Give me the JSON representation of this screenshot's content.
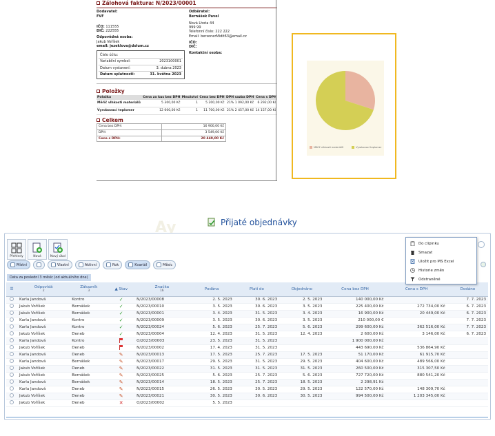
{
  "invoice": {
    "title": "Zálohová faktura: N/2023/00001",
    "supplier_label": "Dodavatel:",
    "supplier_name": "FVF",
    "ico_label": "IČO:",
    "ico_value": "111555",
    "dic_label": "DIČ:",
    "dic_value": "222555",
    "contact_label": "Odpovědná osoba:",
    "contact_name": "Jakub Voříšek",
    "contact_email": "email: jezeklova@dolum.cz",
    "customer_label": "Odběratel:",
    "customer_name": "Bernášek Pavel",
    "customer_lines": [
      "Nová Lhota 44",
      "999 99",
      "Telefonní číslo: 222 222",
      "Email: bersonerMidit63@email.cz"
    ],
    "customer_ico_label": "IČO:",
    "customer_dic_label": "DIČ:",
    "customer_contact_label": "Kontaktní osoba:",
    "box": {
      "account_label": "Číslo účtu:",
      "vs_label": "Variabilní symbol:",
      "vs_value": "2023100001",
      "issued_label": "Datum vystavení:",
      "issued_value": "3. dubna 2023",
      "due_label": "Datum splatnosti:",
      "due_value": "31. května 2023"
    },
    "items_title": "Položky",
    "items_headers": [
      "Položka",
      "Cena za kus bez DPH",
      "Množství",
      "Cena bez DPH",
      "DPH sazba DPH",
      "Cena s DPH"
    ],
    "items": [
      {
        "name": "Měřič vlhkosti materiálů",
        "unit": "5 300,00 Kč",
        "qty": "1",
        "net": "5 200,00 Kč",
        "vat": "21% 1 092,00 Kč",
        "gross": "6 292,00 Kč"
      },
      {
        "name": "Vyrobovací teplomer",
        "unit": "12 600,00 Kč",
        "qty": "1",
        "net": "11 700,00 Kč",
        "vat": "21% 2 457,00 Kč",
        "gross": "14 157,00 Kč"
      }
    ],
    "totals_title": "Celkem",
    "totals": [
      {
        "label": "Cena bez DPH:",
        "value": "16 900,00 Kč"
      },
      {
        "label": "DPH:",
        "value": "3 549,00 Kč"
      },
      {
        "label": "Cena s DPH:",
        "value": "20 449,00 Kč"
      }
    ]
  },
  "chart_data": {
    "type": "pie",
    "values": [
      0.3,
      0.7
    ],
    "colors": [
      "#e8b4a0",
      "#d4cf55"
    ],
    "legend": [
      "Měřič vlhkosti materiálů",
      "Vyrobovací teplomer"
    ]
  },
  "app": {
    "title": "Přijaté objednávky",
    "watermark": "Ay",
    "toolbar": [
      {
        "label": "Přehledy",
        "icon": "overview-grid-icon"
      },
      {
        "label": "Nová",
        "icon": "new-order-icon"
      },
      {
        "label": "Nový úkol",
        "icon": "new-task-icon"
      }
    ],
    "filters": [
      {
        "label": "Místní",
        "icon": "filter-icon"
      },
      {
        "label": "",
        "icon": "filter-mode-icon"
      },
      {
        "label": "Vlastní",
        "icon": "custom-filter-icon"
      },
      {
        "label": "Aktivní",
        "icon": "active-filter-icon"
      },
      {
        "label": "Rok",
        "icon": "calendar-year-icon"
      },
      {
        "label": "Kvartál",
        "icon": "calendar-quarter-icon"
      },
      {
        "label": "Měsíc",
        "icon": "calendar-month-icon"
      }
    ],
    "range_label": "Data za poslední 3 měsíc (od aktuálního dne)",
    "columns": {
      "menu": "☰",
      "owner": "Odpovídá",
      "owner_sub": "2",
      "customer": "Zákazník",
      "customer_sub": "3",
      "status": "Stav",
      "code": "Značka",
      "code_sub": "16",
      "filed": "Podána",
      "valid": "Platí do",
      "ordered": "Objednáno",
      "net": "Cena bez DPH",
      "gross": "Cena s DPH",
      "delivered": "Dodáno"
    },
    "rows": [
      {
        "owner": "Karla Jandová",
        "customer": "Kontro",
        "status": "ok",
        "code": "N/2023/00008",
        "filed": "2. 5. 2023",
        "valid": "30. 6. 2023",
        "ordered": "2. 5. 2023",
        "net": "140 000,00 Kč",
        "gross": "",
        "delivered": "7. 7. 2023"
      },
      {
        "owner": "Jakub Voříšek",
        "customer": "Bernášek",
        "status": "ok",
        "code": "N/2023/00010",
        "filed": "3. 5. 2023",
        "valid": "30. 6. 2023",
        "ordered": "3. 5. 2023",
        "net": "225 400,00 Kč",
        "gross": "272 734,00 Kč",
        "delivered": "6. 7. 2023"
      },
      {
        "owner": "Jakub Voříšek",
        "customer": "Bernášek",
        "status": "ok",
        "code": "N/2023/00001",
        "filed": "3. 4. 2023",
        "valid": "31. 5. 2023",
        "ordered": "3. 4. 2023",
        "net": "16 900,00 Kč",
        "gross": "20 449,00 Kč",
        "delivered": "6. 7. 2023"
      },
      {
        "owner": "Karla Jandová",
        "customer": "Kontro",
        "status": "ok",
        "code": "N/2023/00009",
        "filed": "3. 5. 2023",
        "valid": "30. 6. 2023",
        "ordered": "3. 5. 2023",
        "net": "210 000,00 €",
        "gross": "",
        "delivered": "7. 7. 2023"
      },
      {
        "owner": "Karla Jandová",
        "customer": "Kontro",
        "status": "ok",
        "code": "N/2023/00024",
        "filed": "5. 6. 2023",
        "valid": "25. 7. 2023",
        "ordered": "5. 6. 2023",
        "net": "299 600,00 Kč",
        "gross": "362 516,00 Kč",
        "delivered": "7. 7. 2023"
      },
      {
        "owner": "Jakub Voříšek",
        "customer": "Deneb",
        "status": "ok",
        "code": "N/2023/00004",
        "filed": "12. 4. 2023",
        "valid": "31. 5. 2023",
        "ordered": "12. 4. 2023",
        "net": "2 600,00 Kč",
        "gross": "3 146,00 Kč",
        "delivered": "6. 7. 2023"
      },
      {
        "owner": "Karla Jandová",
        "customer": "Kontro",
        "status": "flag",
        "code": "O/2023/00003",
        "filed": "23. 5. 2023",
        "valid": "31. 5. 2023",
        "ordered": "",
        "net": "1 900 000,00 Kč",
        "gross": "",
        "delivered": ""
      },
      {
        "owner": "Jakub Voříšek",
        "customer": "Deneb",
        "status": "flag",
        "code": "N/2023/00002",
        "filed": "17. 4. 2023",
        "valid": "31. 5. 2023",
        "ordered": "",
        "net": "443 690,00 Kč",
        "gross": "536 864,90 Kč",
        "delivered": ""
      },
      {
        "owner": "Karla Jandová",
        "customer": "Deneb",
        "status": "pen",
        "code": "N/2023/00013",
        "filed": "17. 5. 2023",
        "valid": "25. 7. 2023",
        "ordered": "17. 5. 2023",
        "net": "51 170,00 Kč",
        "gross": "61 915,70 Kč",
        "delivered": ""
      },
      {
        "owner": "Karla Jandová",
        "customer": "Bernášek",
        "status": "pen",
        "code": "N/2023/00017",
        "filed": "29. 5. 2023",
        "valid": "31. 5. 2023",
        "ordered": "29. 5. 2023",
        "net": "404 600,00 Kč",
        "gross": "489 566,00 Kč",
        "delivered": ""
      },
      {
        "owner": "Jakub Voříšek",
        "customer": "Deneb",
        "status": "pen",
        "code": "N/2023/00022",
        "filed": "31. 5. 2023",
        "valid": "31. 5. 2023",
        "ordered": "31. 5. 2023",
        "net": "260 500,00 Kč",
        "gross": "315 307,50 Kč",
        "delivered": ""
      },
      {
        "owner": "Jakub Voříšek",
        "customer": "Bernášek",
        "status": "pen",
        "code": "N/2023/00025",
        "filed": "5. 6. 2023",
        "valid": "25. 7. 2023",
        "ordered": "5. 6. 2023",
        "net": "727 720,00 Kč",
        "gross": "880 541,20 Kč",
        "delivered": ""
      },
      {
        "owner": "Karla Jandová",
        "customer": "Bernášek",
        "status": "pen",
        "code": "N/2023/00014",
        "filed": "18. 5. 2023",
        "valid": "25. 7. 2023",
        "ordered": "18. 5. 2023",
        "net": "2 298,91 Kč",
        "gross": "",
        "delivered": ""
      },
      {
        "owner": "Karla Jandová",
        "customer": "Deneb",
        "status": "pen",
        "code": "N/2023/00015",
        "filed": "26. 5. 2023",
        "valid": "30. 5. 2023",
        "ordered": "29. 5. 2023",
        "net": "122 570,00 Kč",
        "gross": "148 309,70 Kč",
        "delivered": ""
      },
      {
        "owner": "Jakub Voříšek",
        "customer": "Deneb",
        "status": "pen",
        "code": "N/2023/00021",
        "filed": "30. 5. 2023",
        "valid": "30. 6. 2023",
        "ordered": "30. 5. 2023",
        "net": "994 500,00 Kč",
        "gross": "1 203 345,00 Kč",
        "delivered": ""
      },
      {
        "owner": "Jakub Voříšek",
        "customer": "Deneb",
        "status": "x",
        "code": "O/2023/00002",
        "filed": "5. 5. 2023",
        "valid": "",
        "ordered": "",
        "net": "",
        "gross": "",
        "delivered": ""
      }
    ],
    "context_menu": [
      {
        "label": "Do clipinku",
        "icon": "clipboard-icon"
      },
      {
        "label": "Smazat",
        "icon": "trash-icon"
      },
      {
        "label": "Uložit pro MS Excel",
        "icon": "excel-export-icon"
      },
      {
        "label": "Historie změn",
        "icon": "history-icon"
      },
      {
        "label": "Odstraněné",
        "icon": "deleted-filter-icon"
      }
    ],
    "colors": {
      "accent": "#3566a5",
      "ok": "#2e9a2e",
      "error": "#d02020",
      "chart_frame": "#f0b820"
    }
  }
}
